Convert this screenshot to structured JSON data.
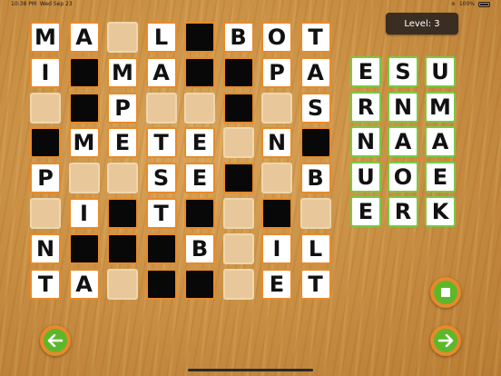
{
  "status": {
    "time": "10:38 PM",
    "date": "Wed Sep 23",
    "battery": "100%"
  },
  "level_label": "Level: 3",
  "board": [
    [
      "M",
      "A",
      "_",
      "L",
      "#",
      "B",
      "O",
      "T"
    ],
    [
      "I",
      "#",
      "M",
      "A",
      "#",
      "#",
      "P",
      "A"
    ],
    [
      "_",
      "#",
      "P",
      "_",
      "_",
      "#",
      "_",
      "S"
    ],
    [
      "#",
      "M",
      "E",
      "T",
      "E",
      "_",
      "N",
      "#"
    ],
    [
      "P",
      "_",
      "_",
      "S",
      "E",
      "#",
      "_",
      "B"
    ],
    [
      "_",
      "I",
      "#",
      "T",
      "#",
      "_",
      "#",
      "_"
    ],
    [
      "N",
      "#",
      "#",
      "#",
      "B",
      "_",
      "I",
      "L"
    ],
    [
      "T",
      "A",
      "_",
      "#",
      "#",
      "_",
      "E",
      "T"
    ]
  ],
  "tray": [
    [
      "E",
      "S",
      "U"
    ],
    [
      "R",
      "N",
      "M"
    ],
    [
      "N",
      "A",
      "A"
    ],
    [
      "U",
      "O",
      "E"
    ],
    [
      "E",
      "R",
      "K"
    ]
  ],
  "colors": {
    "tile_border": "#e98a2a",
    "tray_border": "#7ac943",
    "button_green": "#5cb82a",
    "button_orange": "#e8892a"
  },
  "icons": {
    "back": "arrow-left-icon",
    "forward": "arrow-right-icon",
    "stop": "stop-square-icon"
  }
}
